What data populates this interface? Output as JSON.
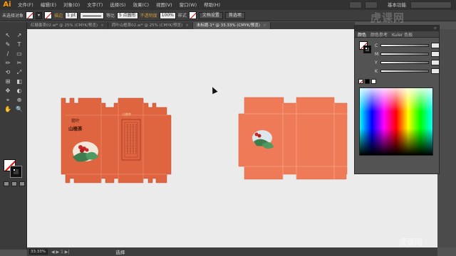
{
  "app": {
    "logo": "Ai"
  },
  "menu": {
    "items": [
      "文件(F)",
      "编辑(E)",
      "对象(O)",
      "文字(T)",
      "选择(S)",
      "效果(C)",
      "视图(V)",
      "窗口(W)",
      "帮助(H)"
    ],
    "basic_function": "基本功能"
  },
  "control": {
    "no_selection": "未选择对象",
    "stroke_label": "描边",
    "stroke_weight": "1 pt",
    "stroke_style": "等比",
    "brush_size": "5 点圆形",
    "opacity_label": "不透明度",
    "opacity_value": "100%",
    "style_label": "样式",
    "doc_setup": "文档设置",
    "prefs": "首选项"
  },
  "tabs": [
    {
      "label": "红糖姜茶02.ai* @ 25% (CMYK/预览)",
      "active": false
    },
    {
      "label": "荷叶山楂茶02.ai* @ 25% (CMYK/预览)",
      "active": false
    },
    {
      "label": "未标题-1* @ 33.33% (CMYK/预览)",
      "active": true
    }
  ],
  "tab_close": "×",
  "tools": [
    "↖",
    "↗",
    "✎",
    "T",
    "/",
    "▭",
    "✏",
    "✂",
    "⟲",
    "⤢",
    "⊞",
    "◧",
    "✥",
    "◐",
    "⌖",
    "⊕",
    "✋",
    "🔍"
  ],
  "color_panel": {
    "tabs": [
      "颜色",
      "颜色参考",
      "Kuler 色板"
    ],
    "channels": [
      "C",
      "M",
      "Y",
      "K"
    ],
    "menu_icon": "≡"
  },
  "box_left": {
    "brand_top": "荷叶",
    "brand_main": "山楂茶",
    "small_logo": "山楂茶"
  },
  "status": {
    "zoom": "33.33%",
    "nav": "◀ ▶ 1 ▶|",
    "tool": "选择"
  },
  "watermark": "虎课网",
  "watermark_small": "虎课网",
  "colors": {
    "box_orange": "#df6440",
    "box_orange_light": "#ee7a57",
    "canvas": "#ebebeb"
  }
}
